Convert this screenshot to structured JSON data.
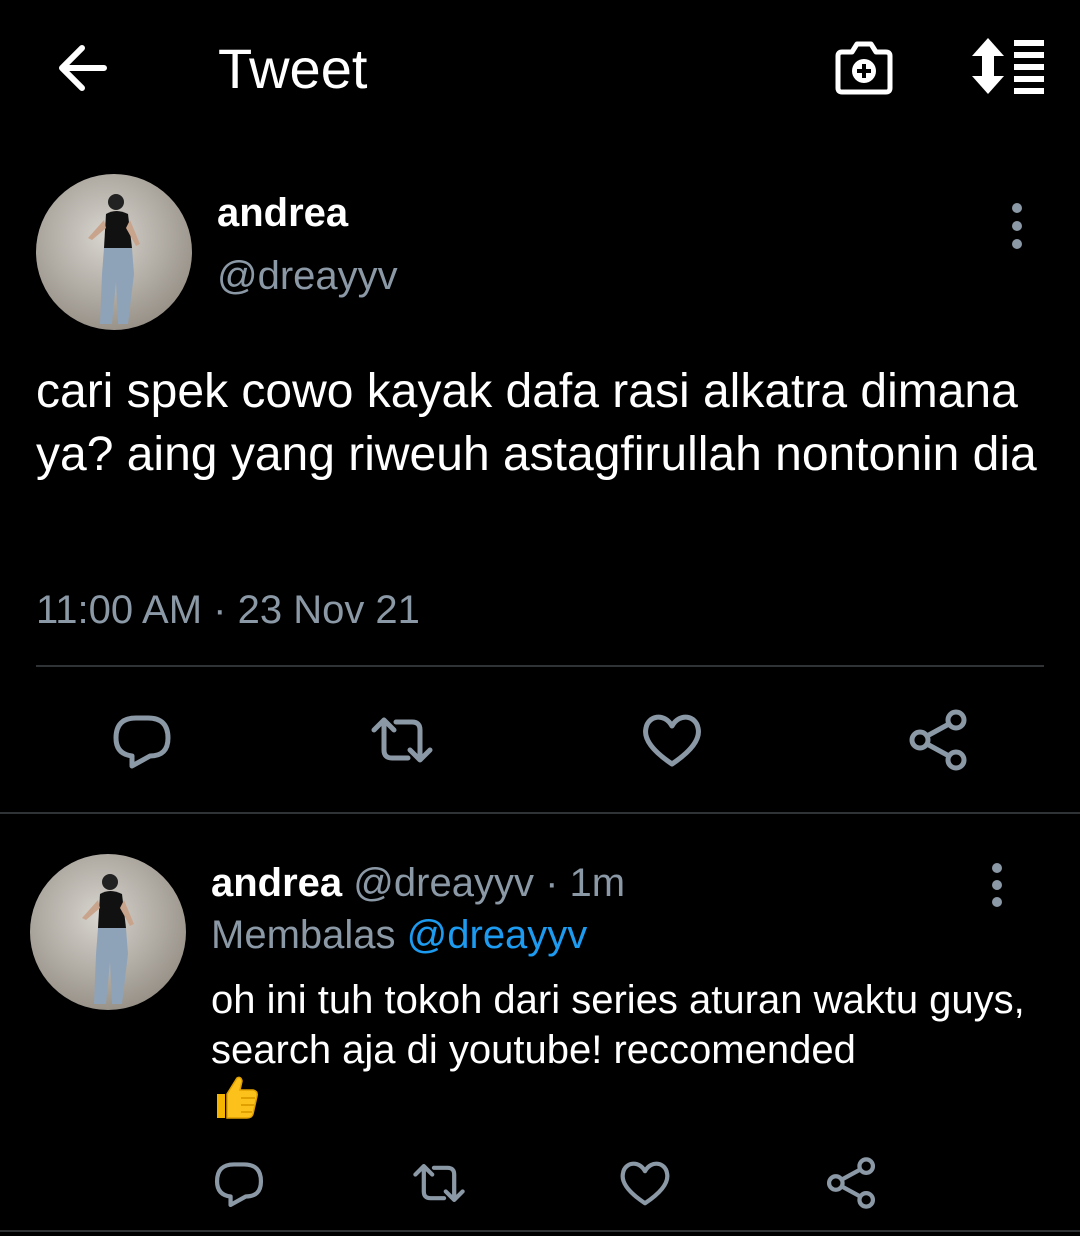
{
  "header": {
    "title": "Tweet",
    "back_icon": "arrow-left-icon",
    "camera_icon": "camera-plus-icon",
    "sort_icon": "sort-list-icon"
  },
  "tweet": {
    "author_name": "andrea",
    "author_handle": "@dreayyv",
    "text": "cari spek cowo kayak dafa rasi alkatra dimana ya? aing yang riweuh astagfirullah nontonin dia",
    "timestamp": "11:00 AM · 23 Nov 21",
    "actions": [
      "reply-icon",
      "retweet-icon",
      "like-icon",
      "share-icon"
    ]
  },
  "reply": {
    "author_name": "andrea",
    "author_handle": "@dreayyv",
    "separator": "·",
    "age": "1m",
    "replying_label": "Membalas",
    "replying_to": "@dreayyv",
    "text": "oh ini tuh tokoh dari series aturan waktu guys, search aja di youtube! reccomended",
    "emoji": "👍"
  },
  "colors": {
    "background": "#000000",
    "text": "#ffffff",
    "secondary": "#8b98a5",
    "accent": "#1d9bf0",
    "divider": "#2f3336"
  }
}
